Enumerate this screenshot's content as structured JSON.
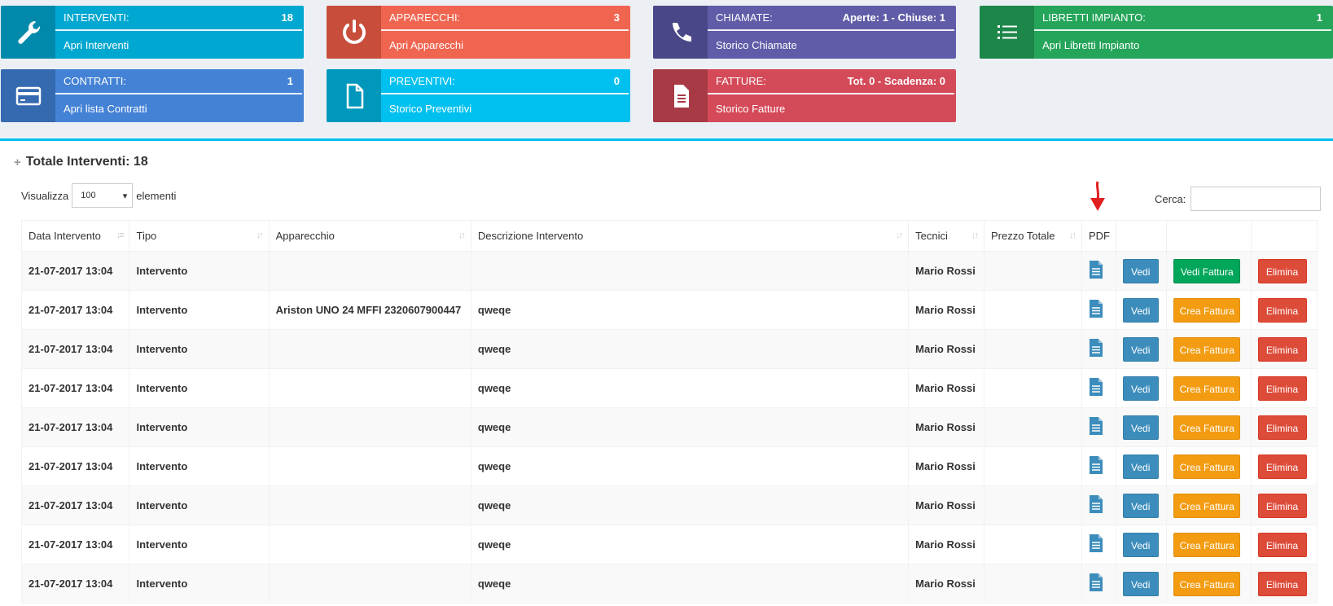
{
  "tiles": [
    {
      "label": "INTERVENTI:",
      "value": "18",
      "link": "Apri Interventi",
      "icon": "wrench-icon",
      "color": "#00a7d0",
      "dark": "#0089ab"
    },
    {
      "label": "APPARECCHI:",
      "value": "3",
      "link": "Apri Apparecchi",
      "icon": "power-icon",
      "color": "#f06550",
      "dark": "#c84e3b"
    },
    {
      "label": "CHIAMATE:",
      "value": "Aperte: 1 - Chiuse: 1",
      "link": "Storico Chiamate",
      "icon": "phone-icon",
      "color": "#605ca8",
      "dark": "#4a4789"
    },
    {
      "label": "LIBRETTI IMPIANTO:",
      "value": "1",
      "link": "Apri Libretti Impianto",
      "icon": "list-icon",
      "color": "#25a55a",
      "dark": "#1d8649"
    },
    {
      "label": "CONTRATTI:",
      "value": "1",
      "link": "Apri lista Contratti",
      "icon": "credit-card-icon",
      "color": "#4482d6",
      "dark": "#366ab0"
    },
    {
      "label": "PREVENTIVI:",
      "value": "0",
      "link": "Storico Preventivi",
      "icon": "file-icon",
      "color": "#00c0ef",
      "dark": "#0097bc"
    },
    {
      "label": "FATTURE:",
      "value": "Tot. 0 - Scadenza: 0",
      "link": "Storico Fatture",
      "icon": "file-text-icon",
      "color": "#d44a59",
      "dark": "#a83a46"
    }
  ],
  "panel": {
    "title": "Totale Interventi: 18"
  },
  "length_menu": {
    "before": "Visualizza",
    "value": "100",
    "after": "elementi"
  },
  "search": {
    "label": "Cerca:",
    "value": ""
  },
  "table": {
    "headers": [
      "Data Intervento",
      "Tipo",
      "Apparecchio",
      "Descrizione Intervento",
      "Tecnici",
      "Prezzo Totale",
      "PDF",
      "",
      "",
      ""
    ],
    "rows": [
      {
        "data": "21-07-2017 13:04",
        "tipo": "Intervento",
        "apparecchio": "",
        "descrizione": "",
        "tecnici": "Mario Rossi",
        "prezzo": "",
        "view": "Vedi",
        "invoice": "Vedi Fattura",
        "invoice_kind": "green",
        "delete": "Elimina"
      },
      {
        "data": "21-07-2017 13:04",
        "tipo": "Intervento",
        "apparecchio": "Ariston UNO 24 MFFI 2320607900447",
        "descrizione": "qweqe",
        "tecnici": "Mario Rossi",
        "prezzo": "",
        "view": "Vedi",
        "invoice": "Crea Fattura",
        "invoice_kind": "orange",
        "delete": "Elimina"
      },
      {
        "data": "21-07-2017 13:04",
        "tipo": "Intervento",
        "apparecchio": "",
        "descrizione": "qweqe",
        "tecnici": "Mario Rossi",
        "prezzo": "",
        "view": "Vedi",
        "invoice": "Crea Fattura",
        "invoice_kind": "orange",
        "delete": "Elimina"
      },
      {
        "data": "21-07-2017 13:04",
        "tipo": "Intervento",
        "apparecchio": "",
        "descrizione": "qweqe",
        "tecnici": "Mario Rossi",
        "prezzo": "",
        "view": "Vedi",
        "invoice": "Crea Fattura",
        "invoice_kind": "orange",
        "delete": "Elimina"
      },
      {
        "data": "21-07-2017 13:04",
        "tipo": "Intervento",
        "apparecchio": "",
        "descrizione": "qweqe",
        "tecnici": "Mario Rossi",
        "prezzo": "",
        "view": "Vedi",
        "invoice": "Crea Fattura",
        "invoice_kind": "orange",
        "delete": "Elimina"
      },
      {
        "data": "21-07-2017 13:04",
        "tipo": "Intervento",
        "apparecchio": "",
        "descrizione": "qweqe",
        "tecnici": "Mario Rossi",
        "prezzo": "",
        "view": "Vedi",
        "invoice": "Crea Fattura",
        "invoice_kind": "orange",
        "delete": "Elimina"
      },
      {
        "data": "21-07-2017 13:04",
        "tipo": "Intervento",
        "apparecchio": "",
        "descrizione": "qweqe",
        "tecnici": "Mario Rossi",
        "prezzo": "",
        "view": "Vedi",
        "invoice": "Crea Fattura",
        "invoice_kind": "orange",
        "delete": "Elimina"
      },
      {
        "data": "21-07-2017 13:04",
        "tipo": "Intervento",
        "apparecchio": "",
        "descrizione": "qweqe",
        "tecnici": "Mario Rossi",
        "prezzo": "",
        "view": "Vedi",
        "invoice": "Crea Fattura",
        "invoice_kind": "orange",
        "delete": "Elimina"
      },
      {
        "data": "21-07-2017 13:04",
        "tipo": "Intervento",
        "apparecchio": "",
        "descrizione": "qweqe",
        "tecnici": "Mario Rossi",
        "prezzo": "",
        "view": "Vedi",
        "invoice": "Crea Fattura",
        "invoice_kind": "orange",
        "delete": "Elimina"
      }
    ]
  }
}
